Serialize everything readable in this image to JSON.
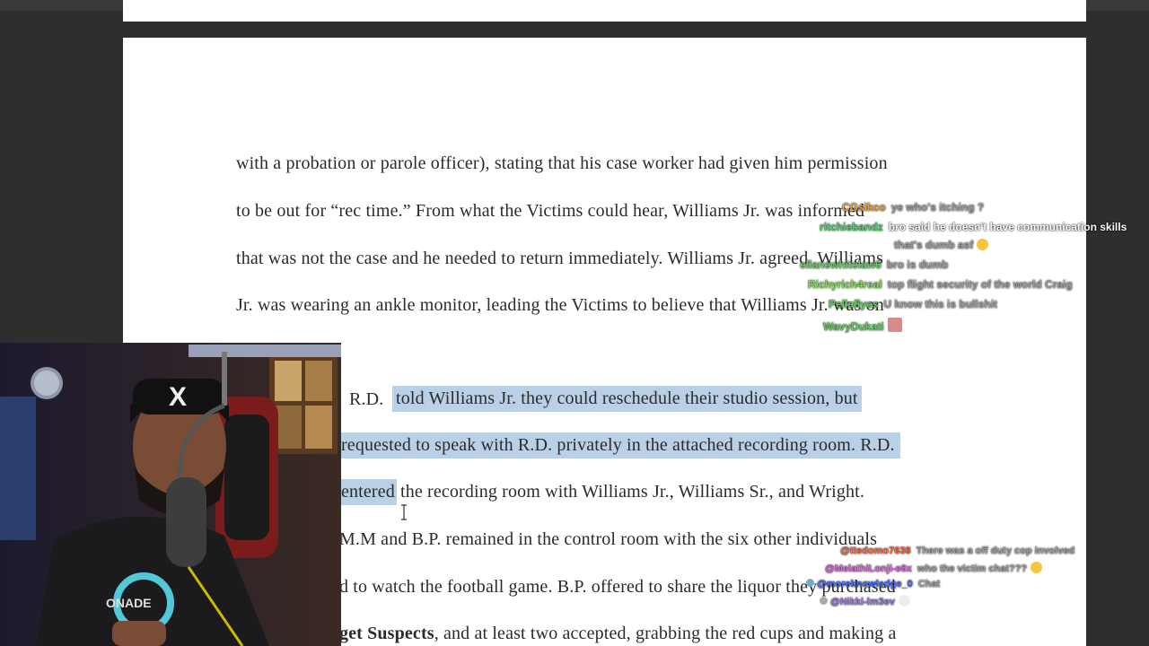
{
  "document": {
    "lines": [
      "with a probation or parole officer), stating that his case worker had given him permission",
      "to be out for “rec time.” From what the Victims could hear, Williams Jr. was informed",
      "that was not the case and he needed to return immediately. Williams Jr. agreed. Williams",
      "Jr. was wearing an ankle monitor, leading the Victims to believe that Williams Jr. was on",
      "R.D.",
      "told Williams Jr. they could reschedule their studio session, but",
      "requested to speak with R.D. privately in the attached recording room. R.D.",
      "entered",
      "the recording room with Williams Jr., Williams Sr., and Wright.",
      "M.M and B.P. remained in the control room with the six other individuals",
      "d to watch the football game. B.P. offered to share the liquor they purchased",
      "get Suspects",
      ", and at least two accepted, grabbing the red cups and making a"
    ]
  },
  "chat_top": [
    {
      "user": "CGsikco",
      "user_color": "#e8a23a",
      "message": "ye who's itching ?",
      "strong": false
    },
    {
      "user": "ritchiebandz",
      "user_color": "#4fd06a",
      "message": "bro said he doesn't have communication skills",
      "strong": true
    },
    {
      "user": "",
      "user_color": "#ffffff",
      "message": "that's dumb asf",
      "strong": false
    },
    {
      "user": "ellanewhitelaw6",
      "user_color": "#6ad06a",
      "message": "bro is dumb",
      "strong": false
    },
    {
      "user": "Richyrich4real",
      "user_color": "#7fe04f",
      "message": "top flight security of the world Craig",
      "strong": false
    },
    {
      "user": "Pellaflyes",
      "user_color": "#5fcf5f",
      "message": "U know this is bullshit",
      "strong": false
    },
    {
      "user": "WavyDukati",
      "user_color": "#5fcf5f",
      "message": "",
      "strong": false
    }
  ],
  "chat_bottom": [
    {
      "user": "@ttedomo7638",
      "user_color": "#ff6a4a",
      "message": "There was a off duty cop involved"
    },
    {
      "user": "@MelathiLonji-e6x",
      "user_color": "#d96ad9",
      "message": "who the victim chat???"
    },
    {
      "user": "@moreknowledge_0",
      "user_color": "#4a6aff",
      "message": "Chat"
    },
    {
      "user": "@Nikki-lm3ev",
      "user_color": "#9a7ae0",
      "message": ""
    }
  ],
  "colors": {
    "highlight": "#b9d0e6",
    "page": "#ffffff",
    "background": "#2e2e2e"
  }
}
